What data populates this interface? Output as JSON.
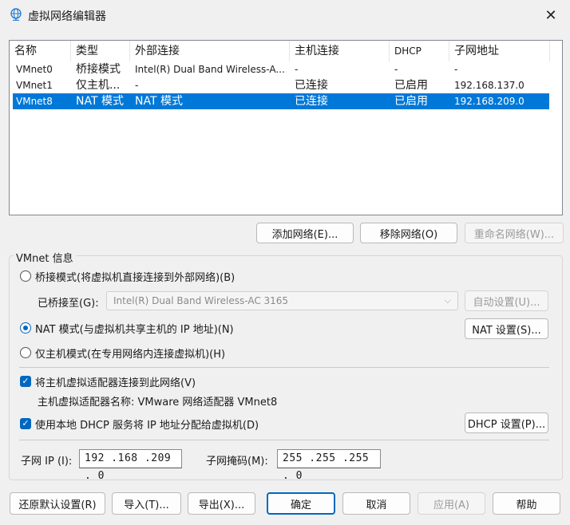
{
  "window": {
    "title": "虚拟网络编辑器",
    "icon": "network-globe-icon",
    "close_glyph": "✕"
  },
  "network_list": {
    "columns": [
      "名称",
      "类型",
      "外部连接",
      "主机连接",
      "DHCP",
      "子网地址"
    ],
    "rows": [
      {
        "name": "VMnet0",
        "type": "桥接模式",
        "external": "Intel(R) Dual Band Wireless-A...",
        "host": "-",
        "dhcp": "-",
        "subnet": "-",
        "selected": false
      },
      {
        "name": "VMnet1",
        "type": "仅主机...",
        "external": "-",
        "host": "已连接",
        "dhcp": "已启用",
        "subnet": "192.168.137.0",
        "selected": false
      },
      {
        "name": "VMnet8",
        "type": "NAT 模式",
        "external": "NAT 模式",
        "host": "已连接",
        "dhcp": "已启用",
        "subnet": "192.168.209.0",
        "selected": true
      }
    ]
  },
  "list_buttons": {
    "add": "添加网络(E)...",
    "remove": "移除网络(O)",
    "rename": "重命名网络(W)..."
  },
  "vmnet_info": {
    "group_label": "VMnet 信息",
    "bridged_label": "桥接模式(将虚拟机直接连接到外部网络)(B)",
    "bridged_to_label": "已桥接至(G):",
    "bridged_to_value": "Intel(R) Dual Band Wireless-AC 3165",
    "auto_settings": "自动设置(U)...",
    "nat_label": "NAT 模式(与虚拟机共享主机的 IP 地址)(N)",
    "nat_settings": "NAT 设置(S)...",
    "hostonly_label": "仅主机模式(在专用网络内连接虚拟机)(H)",
    "connect_adapter_label": "将主机虚拟适配器连接到此网络(V)",
    "adapter_name_text": "主机虚拟适配器名称: VMware 网络适配器 VMnet8",
    "dhcp_label": "使用本地 DHCP 服务将 IP 地址分配给虚拟机(D)",
    "dhcp_settings": "DHCP 设置(P)...",
    "subnet_ip_label": "子网 IP (I):",
    "subnet_ip_value": "192 .168 .209 . 0",
    "subnet_mask_label": "子网掩码(M):",
    "subnet_mask_value": "255 .255 .255 . 0",
    "selected_mode": "nat",
    "connect_adapter_checked": true,
    "dhcp_checked": true
  },
  "footer_buttons": {
    "restore": "还原默认设置(R)",
    "import": "导入(T)...",
    "export": "导出(X)...",
    "ok": "确定",
    "cancel": "取消",
    "apply": "应用(A)",
    "help": "帮助"
  },
  "colors": {
    "accent": "#0067c0",
    "selection": "#0078d7",
    "background": "#f0f0f0"
  }
}
